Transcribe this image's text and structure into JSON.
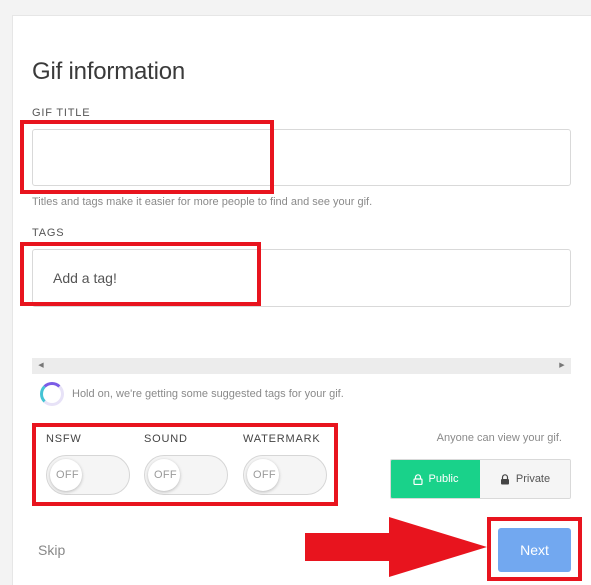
{
  "form": {
    "heading": "Gif information",
    "gif_title": {
      "label": "GIF TITLE",
      "value": "",
      "placeholder": ""
    },
    "helper_text": "Titles and tags make it easier for more people to find and see your gif.",
    "tags": {
      "label": "TAGS",
      "placeholder": "Add a tag!"
    },
    "suggested_tags_loading": "Hold on, we're getting some suggested tags for your gif."
  },
  "toggles": [
    {
      "label": "NSFW",
      "state": "OFF"
    },
    {
      "label": "SOUND",
      "state": "OFF"
    },
    {
      "label": "WATERMARK",
      "state": "OFF"
    }
  ],
  "visibility": {
    "note": "Anyone can view your gif.",
    "public_label": "Public",
    "private_label": "Private",
    "selected": "Public",
    "public_color": "#19d28a"
  },
  "actions": {
    "skip_label": "Skip",
    "next_label": "Next",
    "next_color": "#72a8f0"
  },
  "annotation": {
    "highlight_color": "#e8141e",
    "icons": [
      "lock-icon",
      "scroll-left-icon",
      "scroll-right-icon",
      "loading-spinner-icon",
      "arrow-annotation"
    ]
  }
}
